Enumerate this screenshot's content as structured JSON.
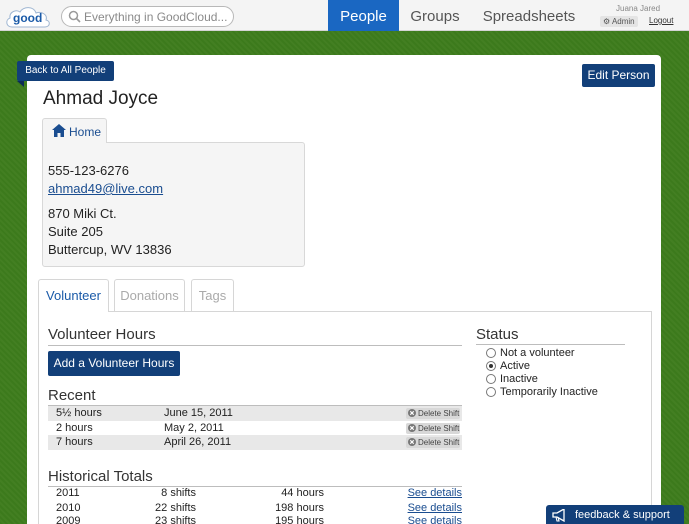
{
  "app": {
    "logo_text": "good",
    "search_placeholder": "Everything in GoodCloud...",
    "nav": [
      "People",
      "Groups",
      "Spreadsheets"
    ],
    "active_nav": "People",
    "user_name": "Juana Jared",
    "admin_label": "Admin",
    "logout_label": "Logout",
    "colors": {
      "accent": "#1a67c2",
      "button": "#123f79",
      "background": "#3f7a1e"
    }
  },
  "person": {
    "back_label": "Back to All People",
    "edit_label": "Edit Person",
    "name": "Ahmad Joyce",
    "home_tab": "Home",
    "home_icon": "house-icon",
    "phone": "555-123-6276",
    "email": "ahmad49@live.com",
    "address": [
      "870 Miki Ct.",
      "Suite 205",
      "Buttercup, WV 13836"
    ]
  },
  "tabs": [
    "Volunteer",
    "Donations",
    "Tags"
  ],
  "active_tab": "Volunteer",
  "volunteer": {
    "hours_title": "Volunteer Hours",
    "add_label": "Add a Volunteer Hours",
    "recent_title": "Recent",
    "delete_label": "Delete Shift",
    "recent": [
      {
        "hours": "5½ hours",
        "date": "June 15, 2011"
      },
      {
        "hours": "2 hours",
        "date": "May 2, 2011"
      },
      {
        "hours": "7 hours",
        "date": "April 26, 2011"
      }
    ],
    "historical_title": "Historical Totals",
    "details_label": "See details",
    "historical": [
      {
        "year": "2011",
        "shifts": "8 shifts",
        "hours": "44 hours"
      },
      {
        "year": "2010",
        "shifts": "22 shifts",
        "hours": "198 hours"
      },
      {
        "year": "2009",
        "shifts": "23 shifts",
        "hours": "195 hours"
      }
    ]
  },
  "status": {
    "title": "Status",
    "options": [
      "Not a volunteer",
      "Active",
      "Inactive",
      "Temporarily Inactive"
    ],
    "selected": "Active"
  },
  "feedback_label": "feedback & support"
}
